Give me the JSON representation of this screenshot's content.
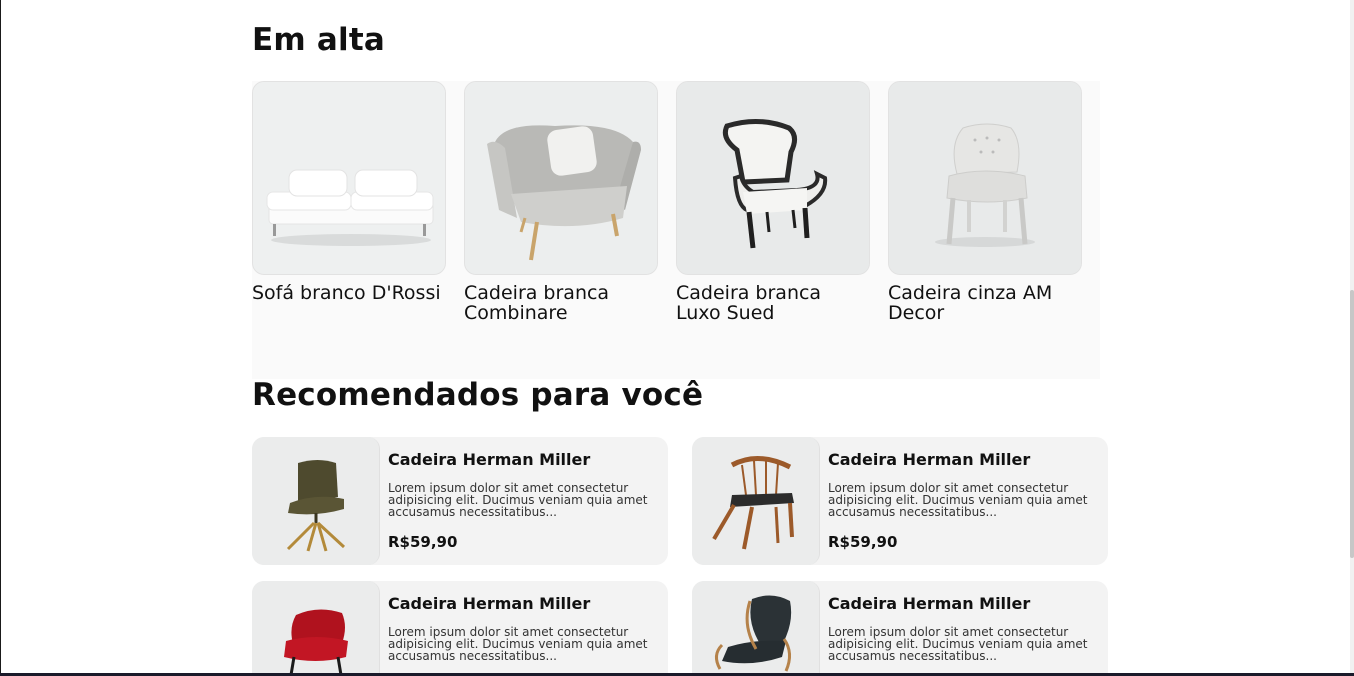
{
  "trending": {
    "title": "Em alta",
    "items": [
      {
        "name": "Sofá branco D'Rossi",
        "icon": "white-sofa"
      },
      {
        "name": "Cadeira branca Combinare",
        "icon": "grey-armchair"
      },
      {
        "name": "Cadeira branca Luxo Sued",
        "icon": "baroque-chair"
      },
      {
        "name": "Cadeira cinza AM Decor",
        "icon": "tufted-chair"
      }
    ]
  },
  "recommended": {
    "title": "Recomendados para você",
    "items": [
      {
        "name": "Cadeira Herman Miller",
        "desc": "Lorem ipsum dolor sit amet consectetur adipisicing elit. Ducimus veniam quia amet accusamus necessitatibus...",
        "price": "R$59,90",
        "icon": "brown-swivel-chair"
      },
      {
        "name": "Cadeira Herman Miller",
        "desc": "Lorem ipsum dolor sit amet consectetur adipisicing elit. Ducimus veniam quia amet accusamus necessitatibus...",
        "price": "R$59,90",
        "icon": "wooden-spindle-chair"
      },
      {
        "name": "Cadeira Herman Miller",
        "desc": "Lorem ipsum dolor sit amet consectetur adipisicing elit. Ducimus veniam quia amet accusamus necessitatibus...",
        "price": "",
        "icon": "red-velvet-chair"
      },
      {
        "name": "Cadeira Herman Miller",
        "desc": "Lorem ipsum dolor sit amet consectetur adipisicing elit. Ducimus veniam quia amet accusamus necessitatibus...",
        "price": "",
        "icon": "black-lounge-chair"
      }
    ]
  },
  "colors": {
    "text": "#111111",
    "card_bg": "#f3f3f3",
    "panel_bg": "#fafafa"
  }
}
